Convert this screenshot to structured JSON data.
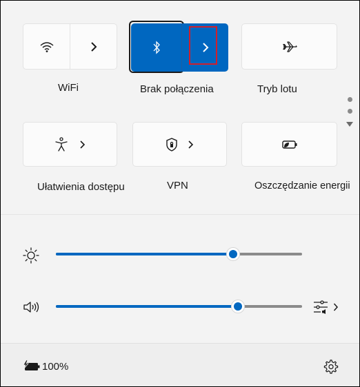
{
  "quick_settings": {
    "wifi": {
      "label": "WiFi",
      "icon": "wifi-icon",
      "expand_icon": "chevron-right-icon"
    },
    "bluetooth": {
      "label": "Brak połączenia",
      "icon": "bluetooth-icon",
      "expand_icon": "chevron-right-icon",
      "active": true
    },
    "airplane": {
      "label": "Tryb lotu",
      "icon": "airplane-icon"
    },
    "accessibility": {
      "label": "Ułatwienia dostępu",
      "icon": "accessibility-icon",
      "expand_icon": "chevron-right-icon"
    },
    "vpn": {
      "label": "VPN",
      "icon": "vpn-shield-icon",
      "expand_icon": "chevron-right-icon"
    },
    "battery_saver": {
      "label": "Oszczędzanie energii",
      "icon": "battery-saver-icon"
    }
  },
  "sliders": {
    "brightness": {
      "icon": "brightness-icon",
      "level": 0.72
    },
    "volume": {
      "icon": "speaker-icon",
      "level": 0.74,
      "mixer_icon": "sound-mixer-icon"
    }
  },
  "footer": {
    "battery_percent": "100%",
    "battery_icon": "battery-charging-icon",
    "settings_icon": "gear-icon"
  },
  "colors": {
    "accent": "#0067c0",
    "highlight": "#d21f2b"
  }
}
